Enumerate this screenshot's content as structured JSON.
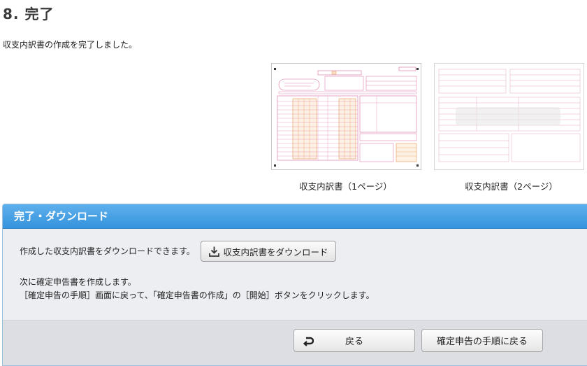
{
  "step": {
    "title": "8. 完了"
  },
  "intro": "収支内訳書の作成を完了しました。",
  "thumbnails": [
    {
      "caption": "収支内訳書（1ページ）"
    },
    {
      "caption": "収支内訳書（2ページ）"
    }
  ],
  "panel": {
    "title": "完了・ダウンロード",
    "download_text": "作成した収支内訳書をダウンロードできます。",
    "download_button": "収支内訳書をダウンロード",
    "next_line1": "次に確定申告書を作成します。",
    "next_line2": "［確定申告の手順］画面に戻って、「確定申告書の作成」の［開始］ボタンをクリックします。",
    "back_button": "戻る",
    "guide_button": "確定申告の手順に戻る"
  },
  "colors": {
    "header": "#3a9ae2",
    "form_orange": "#e0883a",
    "form_pink": "#d86aa0"
  },
  "icons": {
    "download": "download-icon",
    "back": "return-arrow-icon"
  }
}
